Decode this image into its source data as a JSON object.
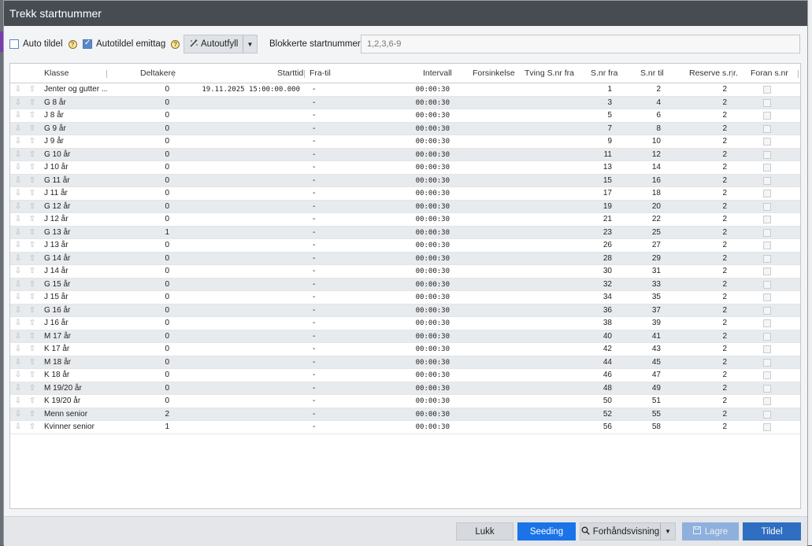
{
  "window": {
    "title": "Trekk startnummer"
  },
  "toolbar": {
    "auto_assign_label": "Auto tildel",
    "auto_assign_checked": false,
    "auto_assign_emit_label": "Autotildel emittag",
    "auto_assign_emit_checked": true,
    "autofill_label": "Autoutfyll",
    "blocked_label": "Blokkerte startnummer",
    "blocked_placeholder": "1,2,3,6-9"
  },
  "table": {
    "columns": {
      "klasse": "Klasse",
      "deltakere": "Deltakere",
      "starttid": "Starttid",
      "fratil": "Fra-til",
      "intervall": "Intervall",
      "forsinkelse": "Forsinkelse",
      "tving": "Tving S.nr fra",
      "snrfra": "S.nr fra",
      "snrtil": "S.nr til",
      "reserve": "Reserve s.nr.",
      "foran": "Foran s.nr"
    },
    "rows": [
      {
        "klasse": "Jenter og gutter ...",
        "deltakere": "0",
        "starttid": "19.11.2025 15:00:00.000",
        "fratil": "-",
        "intervall": "00:00:30",
        "snrfra": "1",
        "snrtil": "2",
        "reserve": "2"
      },
      {
        "klasse": "G 8 år",
        "deltakere": "0",
        "starttid": "",
        "fratil": "-",
        "intervall": "00:00:30",
        "snrfra": "3",
        "snrtil": "4",
        "reserve": "2"
      },
      {
        "klasse": "J 8 år",
        "deltakere": "0",
        "starttid": "",
        "fratil": "-",
        "intervall": "00:00:30",
        "snrfra": "5",
        "snrtil": "6",
        "reserve": "2"
      },
      {
        "klasse": "G 9 år",
        "deltakere": "0",
        "starttid": "",
        "fratil": "-",
        "intervall": "00:00:30",
        "snrfra": "7",
        "snrtil": "8",
        "reserve": "2"
      },
      {
        "klasse": "J 9 år",
        "deltakere": "0",
        "starttid": "",
        "fratil": "-",
        "intervall": "00:00:30",
        "snrfra": "9",
        "snrtil": "10",
        "reserve": "2"
      },
      {
        "klasse": "G 10 år",
        "deltakere": "0",
        "starttid": "",
        "fratil": "-",
        "intervall": "00:00:30",
        "snrfra": "11",
        "snrtil": "12",
        "reserve": "2"
      },
      {
        "klasse": "J 10 år",
        "deltakere": "0",
        "starttid": "",
        "fratil": "-",
        "intervall": "00:00:30",
        "snrfra": "13",
        "snrtil": "14",
        "reserve": "2"
      },
      {
        "klasse": "G 11 år",
        "deltakere": "0",
        "starttid": "",
        "fratil": "-",
        "intervall": "00:00:30",
        "snrfra": "15",
        "snrtil": "16",
        "reserve": "2"
      },
      {
        "klasse": "J 11 år",
        "deltakere": "0",
        "starttid": "",
        "fratil": "-",
        "intervall": "00:00:30",
        "snrfra": "17",
        "snrtil": "18",
        "reserve": "2"
      },
      {
        "klasse": "G 12 år",
        "deltakere": "0",
        "starttid": "",
        "fratil": "-",
        "intervall": "00:00:30",
        "snrfra": "19",
        "snrtil": "20",
        "reserve": "2"
      },
      {
        "klasse": "J 12 år",
        "deltakere": "0",
        "starttid": "",
        "fratil": "-",
        "intervall": "00:00:30",
        "snrfra": "21",
        "snrtil": "22",
        "reserve": "2"
      },
      {
        "klasse": "G 13 år",
        "deltakere": "1",
        "starttid": "",
        "fratil": "-",
        "intervall": "00:00:30",
        "snrfra": "23",
        "snrtil": "25",
        "reserve": "2"
      },
      {
        "klasse": "J 13 år",
        "deltakere": "0",
        "starttid": "",
        "fratil": "-",
        "intervall": "00:00:30",
        "snrfra": "26",
        "snrtil": "27",
        "reserve": "2"
      },
      {
        "klasse": "G 14 år",
        "deltakere": "0",
        "starttid": "",
        "fratil": "-",
        "intervall": "00:00:30",
        "snrfra": "28",
        "snrtil": "29",
        "reserve": "2"
      },
      {
        "klasse": "J 14 år",
        "deltakere": "0",
        "starttid": "",
        "fratil": "-",
        "intervall": "00:00:30",
        "snrfra": "30",
        "snrtil": "31",
        "reserve": "2"
      },
      {
        "klasse": "G 15 år",
        "deltakere": "0",
        "starttid": "",
        "fratil": "-",
        "intervall": "00:00:30",
        "snrfra": "32",
        "snrtil": "33",
        "reserve": "2"
      },
      {
        "klasse": "J 15 år",
        "deltakere": "0",
        "starttid": "",
        "fratil": "-",
        "intervall": "00:00:30",
        "snrfra": "34",
        "snrtil": "35",
        "reserve": "2"
      },
      {
        "klasse": "G 16 år",
        "deltakere": "0",
        "starttid": "",
        "fratil": "-",
        "intervall": "00:00:30",
        "snrfra": "36",
        "snrtil": "37",
        "reserve": "2"
      },
      {
        "klasse": "J 16 år",
        "deltakere": "0",
        "starttid": "",
        "fratil": "-",
        "intervall": "00:00:30",
        "snrfra": "38",
        "snrtil": "39",
        "reserve": "2"
      },
      {
        "klasse": "M 17 år",
        "deltakere": "0",
        "starttid": "",
        "fratil": "-",
        "intervall": "00:00:30",
        "snrfra": "40",
        "snrtil": "41",
        "reserve": "2"
      },
      {
        "klasse": "K 17 år",
        "deltakere": "0",
        "starttid": "",
        "fratil": "-",
        "intervall": "00:00:30",
        "snrfra": "42",
        "snrtil": "43",
        "reserve": "2"
      },
      {
        "klasse": "M 18 år",
        "deltakere": "0",
        "starttid": "",
        "fratil": "-",
        "intervall": "00:00:30",
        "snrfra": "44",
        "snrtil": "45",
        "reserve": "2"
      },
      {
        "klasse": "K 18 år",
        "deltakere": "0",
        "starttid": "",
        "fratil": "-",
        "intervall": "00:00:30",
        "snrfra": "46",
        "snrtil": "47",
        "reserve": "2"
      },
      {
        "klasse": "M 19/20 år",
        "deltakere": "0",
        "starttid": "",
        "fratil": "-",
        "intervall": "00:00:30",
        "snrfra": "48",
        "snrtil": "49",
        "reserve": "2"
      },
      {
        "klasse": "K 19/20 år",
        "deltakere": "0",
        "starttid": "",
        "fratil": "-",
        "intervall": "00:00:30",
        "snrfra": "50",
        "snrtil": "51",
        "reserve": "2"
      },
      {
        "klasse": "Menn senior",
        "deltakere": "2",
        "starttid": "",
        "fratil": "-",
        "intervall": "00:00:30",
        "snrfra": "52",
        "snrtil": "55",
        "reserve": "2"
      },
      {
        "klasse": "Kvinner senior",
        "deltakere": "1",
        "starttid": "",
        "fratil": "-",
        "intervall": "00:00:30",
        "snrfra": "56",
        "snrtil": "58",
        "reserve": "2"
      }
    ]
  },
  "footer": {
    "close_label": "Lukk",
    "seeding_label": "Seeding",
    "preview_label": "Forhåndsvisning",
    "save_label": "Lagre",
    "assign_label": "Tildel"
  },
  "colors": {
    "title_bar": "#474b52",
    "primary_blue": "#1a73e8",
    "assign_blue": "#2f6ec0",
    "disabled_blue": "#8fb0dd",
    "row_alt": "#e8ebee"
  }
}
